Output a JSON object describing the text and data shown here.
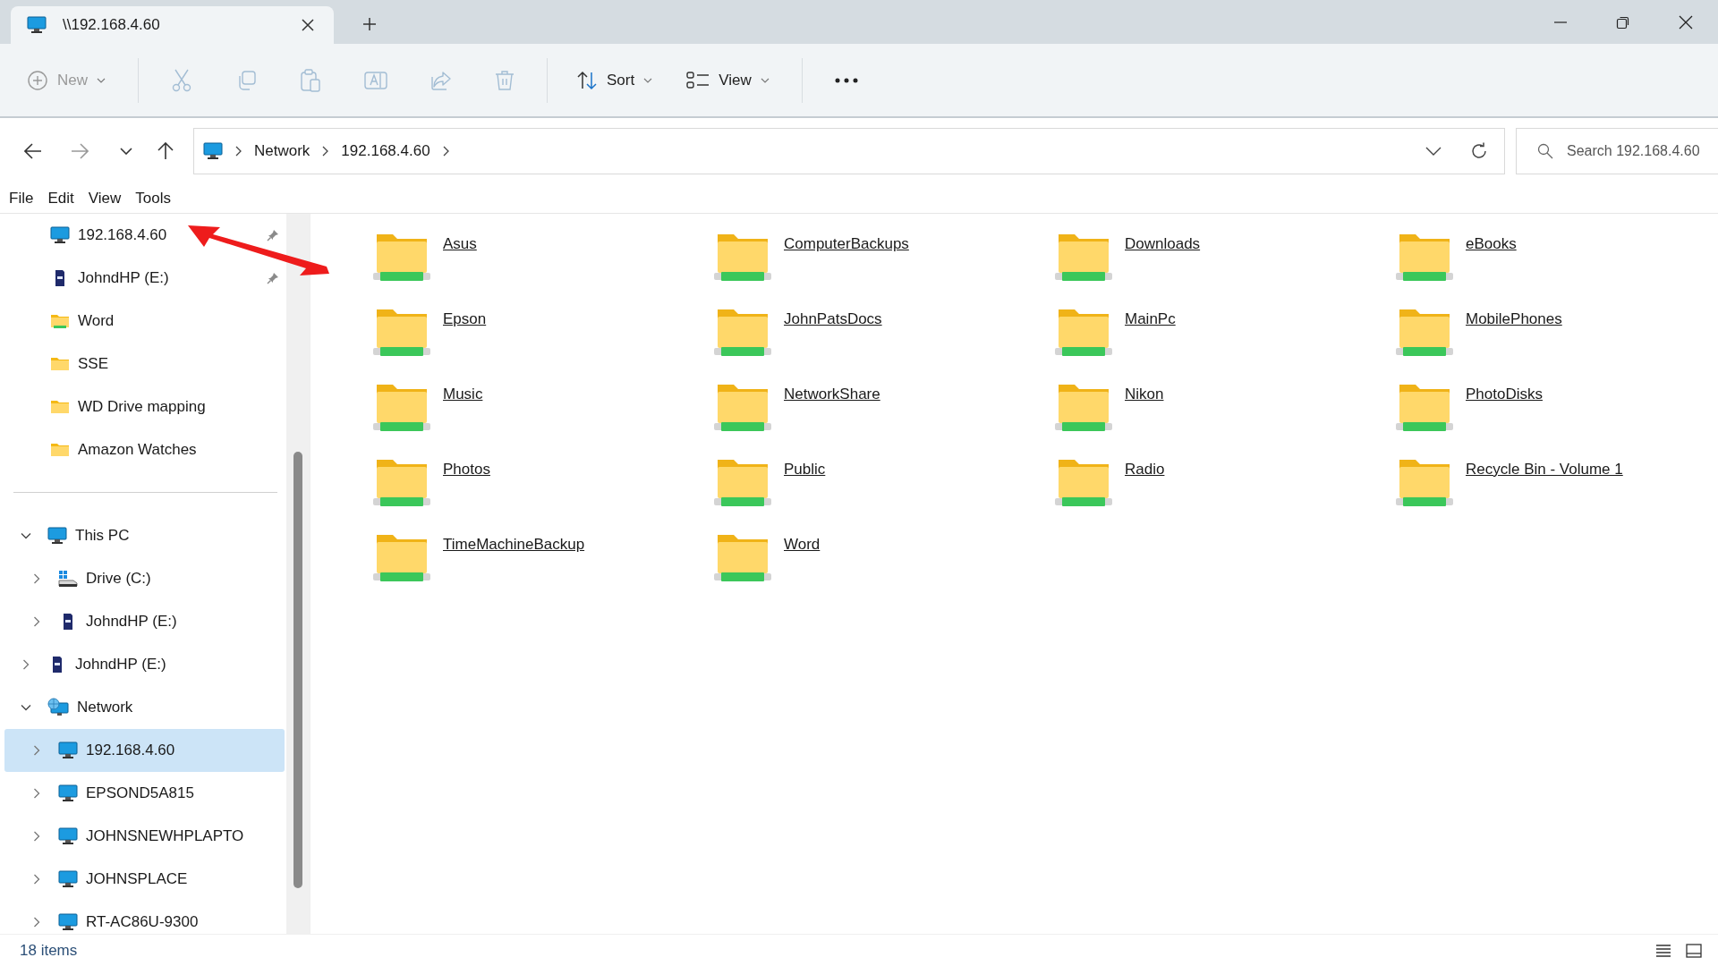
{
  "window": {
    "tab_title": "\\\\192.168.4.60"
  },
  "toolbar": [
    {
      "kind": "new",
      "label": "New",
      "disabled": true
    },
    {
      "kind": "cut",
      "disabled": true
    },
    {
      "kind": "copy",
      "disabled": true
    },
    {
      "kind": "paste",
      "disabled": true
    },
    {
      "kind": "rename",
      "disabled": true
    },
    {
      "kind": "share",
      "disabled": true
    },
    {
      "kind": "delete",
      "disabled": true
    },
    {
      "kind": "sort",
      "label": "Sort",
      "disabled": false
    },
    {
      "kind": "view",
      "label": "View",
      "disabled": false
    },
    {
      "kind": "more",
      "disabled": false
    }
  ],
  "nav": [
    {
      "kind": "back",
      "disabled": false
    },
    {
      "kind": "forward",
      "disabled": true
    },
    {
      "kind": "recent",
      "disabled": false
    },
    {
      "kind": "up",
      "disabled": false
    }
  ],
  "address": {
    "segments": [
      "Network",
      "192.168.4.60"
    ]
  },
  "search": {
    "placeholder": "Search 192.168.4.60"
  },
  "menu": [
    "File",
    "Edit",
    "View",
    "Tools"
  ],
  "sidebar": {
    "quick_access": [
      {
        "label": "192.168.4.60",
        "kind": "monitor",
        "pinned": true
      },
      {
        "label": "JohndHP (E:)",
        "kind": "sdcard",
        "pinned": true
      },
      {
        "label": "Word",
        "kind": "netfolder",
        "pinned": false
      },
      {
        "label": "SSE",
        "kind": "folder",
        "pinned": false
      },
      {
        "label": "WD Drive mapping",
        "kind": "folder",
        "pinned": false
      },
      {
        "label": "Amazon Watches",
        "kind": "folder",
        "pinned": false
      }
    ],
    "tree": [
      {
        "label": "This PC",
        "kind": "monitor",
        "expanded": true,
        "selected": false,
        "children": [
          {
            "label": "Drive (C:)",
            "kind": "drive",
            "expanded": false,
            "selected": false
          },
          {
            "label": "JohndHP (E:)",
            "kind": "sdcard",
            "expanded": false,
            "selected": false
          }
        ]
      },
      {
        "label": "JohndHP (E:)",
        "kind": "sdcard",
        "expanded": false,
        "selected": false
      },
      {
        "label": "Network",
        "kind": "network",
        "expanded": true,
        "selected": false,
        "children": [
          {
            "label": "192.168.4.60",
            "kind": "monitor",
            "expanded": false,
            "selected": true
          },
          {
            "label": "EPSOND5A815",
            "kind": "monitor",
            "expanded": false,
            "selected": false
          },
          {
            "label": "JOHNSNEWHPLAPTO",
            "kind": "monitor",
            "expanded": false,
            "selected": false
          },
          {
            "label": "JOHNSPLACE",
            "kind": "monitor",
            "expanded": false,
            "selected": false
          },
          {
            "label": "RT-AC86U-9300",
            "kind": "monitor",
            "expanded": false,
            "selected": false
          }
        ]
      }
    ]
  },
  "folders": [
    "Asus",
    "ComputerBackups",
    "Downloads",
    "eBooks",
    "Epson",
    "JohnPatsDocs",
    "MainPc",
    "MobilePhones",
    "Music",
    "NetworkShare",
    "Nikon",
    "PhotoDisks",
    "Photos",
    "Public",
    "Radio",
    "Recycle Bin - Volume 1",
    "TimeMachineBackup",
    "Word"
  ],
  "status_bar": {
    "item_count": "18 items"
  }
}
